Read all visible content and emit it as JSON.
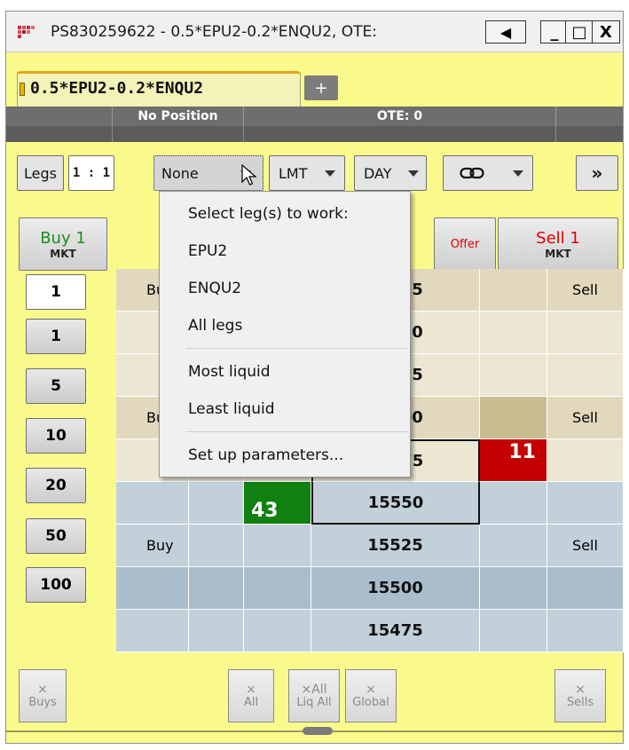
{
  "window": {
    "title": "PS830259622 - 0.5*EPU2-0.2*ENQU2, OTE:",
    "buttons": {
      "sound": "◀",
      "minimize": "_",
      "maximize": "□",
      "close": "X"
    }
  },
  "tabs": {
    "active_label": "0.5*EPU2-0.2*ENQU2",
    "add_label": "+"
  },
  "status": {
    "position": "No Position",
    "ote": "OTE: 0"
  },
  "toolbar": {
    "legs": "Legs",
    "ratio": "1 : 1",
    "leg_select": "None",
    "order_type": "LMT",
    "duration": "DAY",
    "link_icon": "link-icon",
    "more": "»"
  },
  "actions": {
    "buy_line1": "Buy 1",
    "buy_line2": "MKT",
    "offer": "Offer",
    "sell_line1": "Sell 1",
    "sell_line2": "MKT",
    "buy_color": "#1e8c1e",
    "sell_color": "#e00000"
  },
  "quantities": [
    "1",
    "1",
    "5",
    "10",
    "20",
    "50",
    "100"
  ],
  "ladder": {
    "rows": [
      {
        "buy": "Bu",
        "bid": "",
        "price": "15675",
        "ask": "",
        "sell": "Sell"
      },
      {
        "buy": "",
        "bid": "",
        "price": "15650",
        "ask": "",
        "sell": ""
      },
      {
        "buy": "",
        "bid": "",
        "price": "15625",
        "ask": "",
        "sell": ""
      },
      {
        "buy": "Bu",
        "bid": "",
        "price": "15600",
        "ask": "",
        "sell": "Sell"
      },
      {
        "buy": "",
        "bid": "",
        "price": "15575",
        "ask": "11",
        "sell": ""
      },
      {
        "buy": "",
        "bid": "43",
        "price": "15550",
        "ask": "",
        "sell": ""
      },
      {
        "buy": "Buy",
        "bid": "",
        "price": "15525",
        "ask": "",
        "sell": "Sell"
      },
      {
        "buy": "",
        "bid": "",
        "price": "15500",
        "ask": "",
        "sell": ""
      },
      {
        "buy": "",
        "bid": "",
        "price": "15475",
        "ask": "",
        "sell": ""
      }
    ]
  },
  "cancel_buttons": {
    "buys": {
      "icon": "×",
      "label": "Buys"
    },
    "all": {
      "icon": "×",
      "label": "All"
    },
    "liq_all": {
      "icon": "×All",
      "label": "Liq All"
    },
    "global": {
      "icon": "×",
      "label": "Global"
    },
    "sells": {
      "icon": "×",
      "label": "Sells"
    }
  },
  "menu": {
    "header": "Select leg(s) to work:",
    "items": [
      "EPU2",
      "ENQU2",
      "All legs",
      "Most liquid",
      "Least liquid",
      "Set up parameters..."
    ]
  }
}
